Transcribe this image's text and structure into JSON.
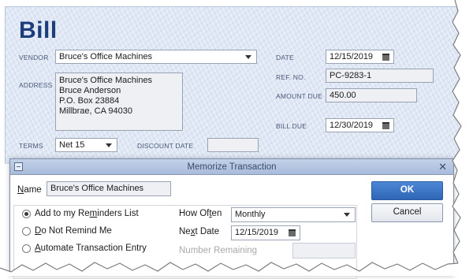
{
  "bill": {
    "title": "Bill",
    "vendor_label": "VENDOR",
    "vendor_value": "Bruce's Office Machines",
    "address_label": "ADDRESS",
    "address_lines": [
      "Bruce's Office Machines",
      "Bruce Anderson",
      "P.O. Box 23884",
      "Millbrae, CA 94030"
    ],
    "date_label": "DATE",
    "date_value": "12/15/2019",
    "ref_label": "REF. NO.",
    "ref_value": "PC-9283-1",
    "amount_label": "AMOUNT DUE",
    "amount_value": "450.00",
    "bill_due_label": "BILL DUE",
    "bill_due_value": "12/30/2019",
    "terms_label": "TERMS",
    "terms_value": "Net 15",
    "discount_label": "DISCOUNT DATE",
    "discount_value": ""
  },
  "dialog": {
    "title": "Memorize Transaction",
    "name_label_pre": "",
    "name_label_u": "N",
    "name_label_post": "ame",
    "name_value": "Bruce's Office Machines",
    "ok_label": "OK",
    "cancel_label": "Cancel",
    "options": [
      {
        "pre": "Add to my Re",
        "u": "m",
        "post": "inders List",
        "selected": true
      },
      {
        "pre": "",
        "u": "D",
        "post": "o Not Remind Me",
        "selected": false
      },
      {
        "pre": "",
        "u": "A",
        "post": "utomate Transaction Entry",
        "selected": false
      }
    ],
    "how_often_pre": "How Of",
    "how_often_u": "t",
    "how_often_post": "en",
    "how_often_value": "Monthly",
    "next_date_pre": "Ne",
    "next_date_u": "x",
    "next_date_post": "t Date",
    "next_date_value": "12/15/2019",
    "number_remaining_label": "Number Remaining",
    "number_remaining_value": ""
  },
  "colors": {
    "bill_background": "#dfe7f5",
    "title_blue": "#1d3c7a",
    "ok_button": "#2f66b6"
  }
}
